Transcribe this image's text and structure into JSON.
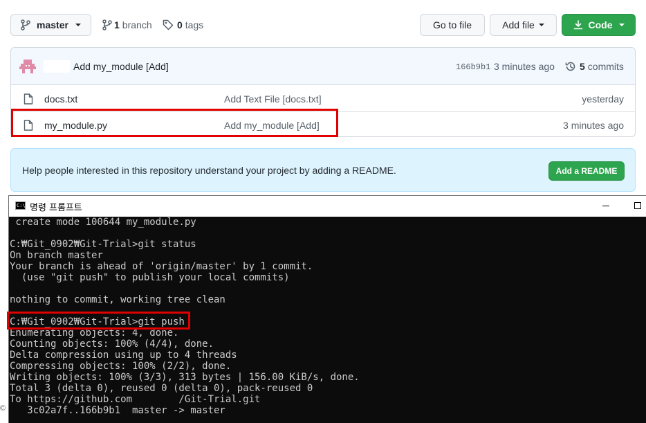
{
  "toolbar": {
    "branch_button": "master",
    "branch_count": "1",
    "branch_label": "branch",
    "tag_count": "0",
    "tag_label": "tags",
    "go_to_file": "Go to file",
    "add_file": "Add file",
    "code": "Code"
  },
  "commit_bar": {
    "message": "Add my_module [Add]",
    "sha": "166b9b1",
    "time": "3 minutes ago",
    "commit_count": "5",
    "commit_label": "commits"
  },
  "files": [
    {
      "name": "docs.txt",
      "message": "Add Text File [docs.txt]",
      "age": "yesterday"
    },
    {
      "name": "my_module.py",
      "message": "Add my_module [Add]",
      "age": "3 minutes ago"
    }
  ],
  "readme": {
    "text": "Help people interested in this repository understand your project by adding a README.",
    "button": "Add a README"
  },
  "cmd_window": {
    "title": "명령 프롬프트",
    "icon_text": "C:\\",
    "lines": [
      " create mode 100644 my_module.py",
      "",
      "C:₩Git_0902₩Git-Trial>git status",
      "On branch master",
      "Your branch is ahead of 'origin/master' by 1 commit.",
      "  (use \"git push\" to publish your local commits)",
      "",
      "nothing to commit, working tree clean",
      "",
      "C:₩Git_0902₩Git-Trial>git push",
      "Enumerating objects: 4, done.",
      "Counting objects: 100% (4/4), done.",
      "Delta compression using up to 4 threads",
      "Compressing objects: 100% (2/2), done.",
      "Writing objects: 100% (3/3), 313 bytes | 156.00 KiB/s, done.",
      "Total 3 (delta 0), reused 0 (delta 0), pack-reused 0",
      "To https://github.com/       /Git-Trial.git",
      "   3c02a7f..166b9b1  master -> master"
    ]
  },
  "colors": {
    "code_button": "#2da44e",
    "readme_banner": "#ddf4ff",
    "highlight": "#e00000",
    "terminal_bg": "#0c0c0c"
  },
  "footer_glyph": "©"
}
